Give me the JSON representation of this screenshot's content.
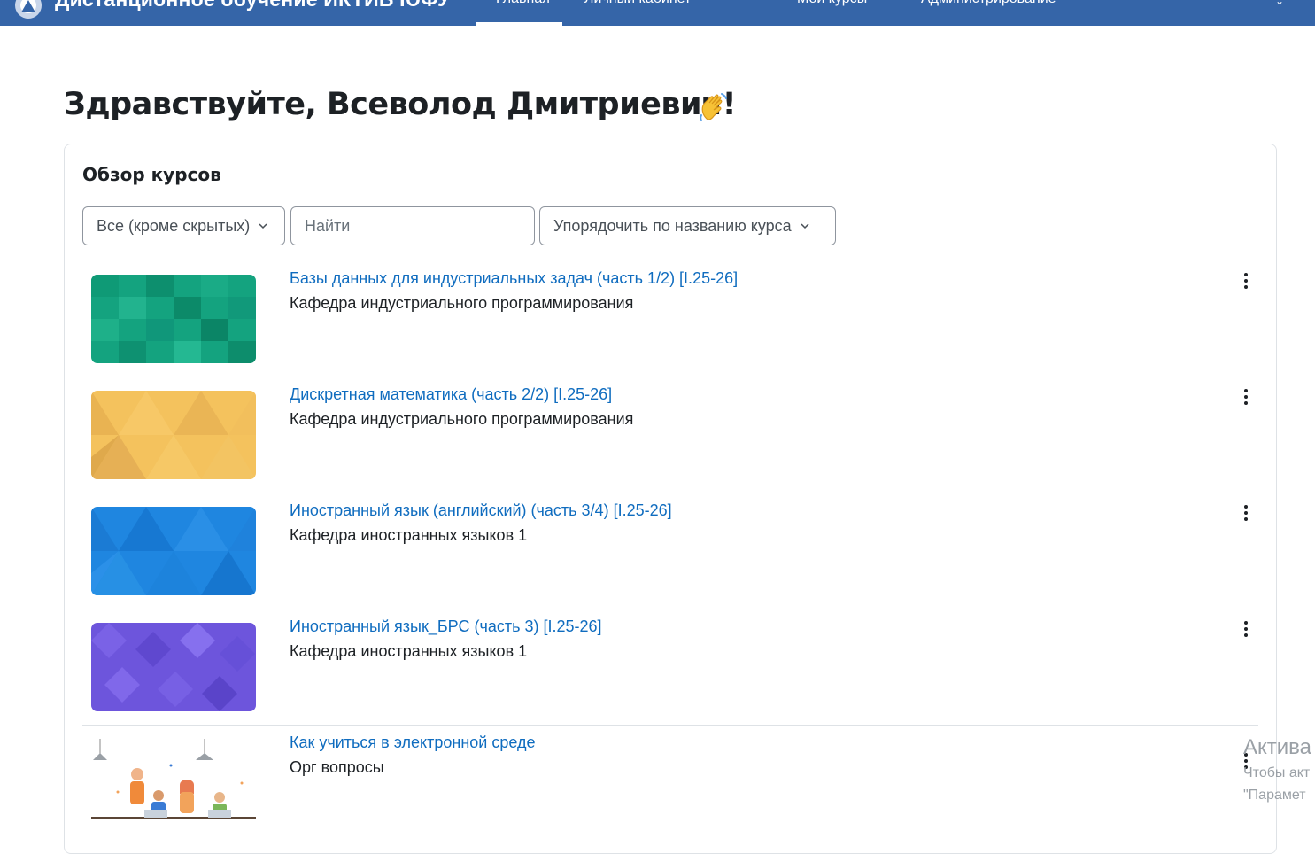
{
  "navbar": {
    "site_name": "Дистанционное обучение ИКТИБ ЮФУ",
    "items": [
      "Главная",
      "Личный кабинет",
      "Мои курсы",
      "Администрирование"
    ]
  },
  "greeting": "Здравствуйте, Всеволод Дмитриевич!",
  "overview": {
    "title": "Обзор курсов",
    "filter_value": "Все (кроме скрытых)",
    "search_placeholder": "Найти",
    "sort_value": "Упорядочить по названию курса"
  },
  "courses": [
    {
      "name": "Базы данных для индустриальных задач (часть 1/2) [I.25-26]",
      "category": "Кафедра индустриального программирования",
      "thumb": "teal-pixel-pattern"
    },
    {
      "name": "Дискретная математика (часть 2/2) [I.25-26]",
      "category": "Кафедра индустриального программирования",
      "thumb": "yellow-triangle-pattern"
    },
    {
      "name": "Иностранный язык (английский) (часть 3/4) [I.25-26]",
      "category": "Кафедра иностранных языков 1",
      "thumb": "blue-triangle-pattern"
    },
    {
      "name": "Иностранный язык_БРС (часть 3) [I.25-26]",
      "category": "Кафедра иностранных языков 1",
      "thumb": "purple-diamond-pattern"
    },
    {
      "name": "Как учиться в электронной среде",
      "category": "Орг вопросы",
      "thumb": "people-at-desks-illustration"
    }
  ],
  "watermark": {
    "line1": "Актива",
    "line2": "Чтобы акт",
    "line3": "\"Парамет"
  },
  "colors": {
    "navbar": "#3565a8",
    "link": "#0f6cbf",
    "text": "#1d2125",
    "border": "#dee2e6"
  }
}
